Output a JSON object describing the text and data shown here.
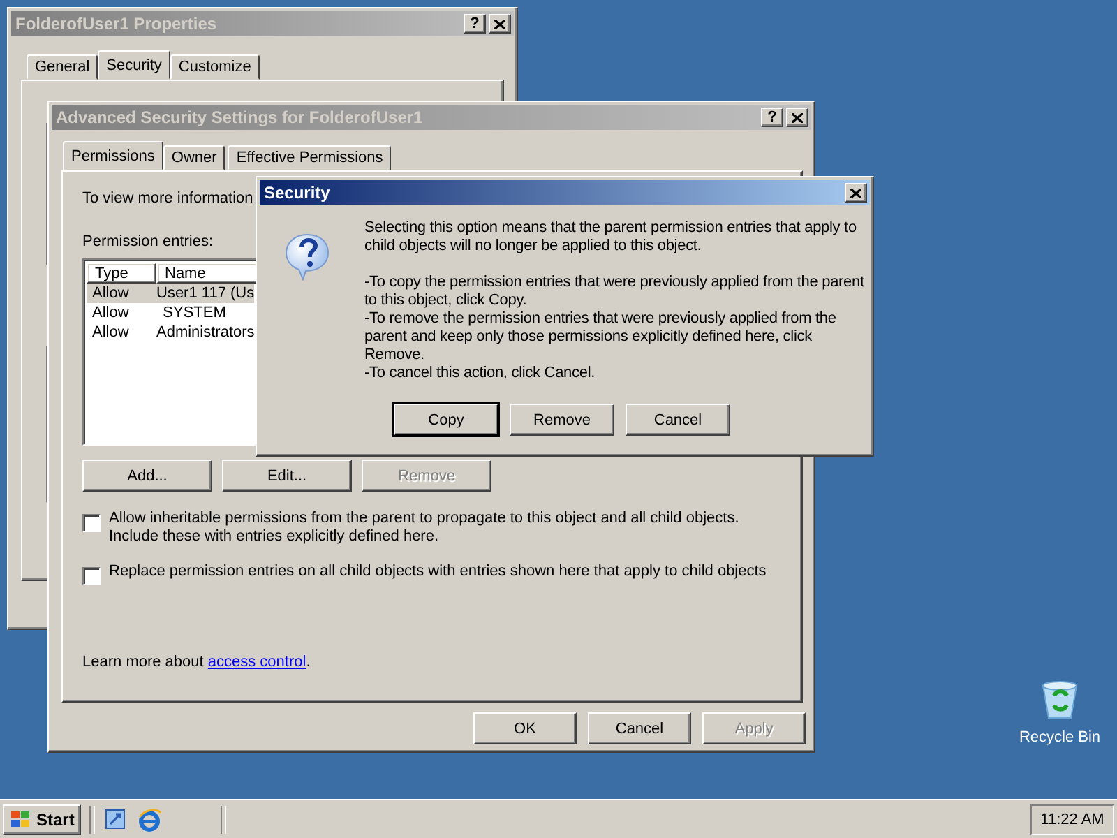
{
  "desktop_icons": [
    {
      "label": "Recycle Bin"
    }
  ],
  "properties_window": {
    "title": "FolderofUser1 Properties",
    "help": "?",
    "active": false,
    "tabs": [
      {
        "label": "General",
        "selected": false
      },
      {
        "label": "Security",
        "selected": true
      },
      {
        "label": "Customize",
        "selected": false
      }
    ]
  },
  "advanced_window": {
    "title": "Advanced Security Settings for FolderofUser1",
    "help": "?",
    "active": false,
    "tabs": [
      {
        "label": "Permissions",
        "selected": true
      },
      {
        "label": "Owner",
        "selected": false
      },
      {
        "label": "Effective Permissions",
        "selected": false
      }
    ],
    "intro": "To view more information",
    "entries_label": "Permission entries:",
    "columns": [
      "Type",
      "Name"
    ],
    "rows": [
      {
        "type": "Allow",
        "name": "User1 117 (Us",
        "selected": true
      },
      {
        "type": "Allow",
        "name": "SYSTEM",
        "selected": false
      },
      {
        "type": "Allow",
        "name": "Administrators",
        "selected": false
      }
    ],
    "entry_buttons": [
      {
        "label": "Add...",
        "disabled": false
      },
      {
        "label": "Edit...",
        "disabled": false
      },
      {
        "label": "Remove",
        "disabled": true
      }
    ],
    "checkboxes": [
      {
        "label": "Allow inheritable permissions from the parent to propagate to this object and all child objects. Include these with entries explicitly defined here.",
        "checked": false
      },
      {
        "label": "Replace permission entries on all child objects with entries shown here that apply to child objects",
        "checked": false
      }
    ],
    "learn_more": {
      "text": "Learn more about ",
      "link": "access control",
      "tail": "."
    },
    "footer_buttons": [
      {
        "label": "OK",
        "disabled": false
      },
      {
        "label": "Cancel",
        "disabled": false
      },
      {
        "label": "Apply",
        "disabled": true
      }
    ]
  },
  "security_dialog": {
    "title": "Security",
    "active": true,
    "paragraphs": [
      "Selecting this option means that the parent permission entries that apply to child objects will no longer be applied to this object.",
      "-To copy  the permission entries that were previously applied from the parent to this object, click Copy.",
      "-To remove the permission entries that were previously applied from the parent and keep only those permissions explicitly defined here, click Remove.",
      "-To cancel this action, click Cancel."
    ],
    "buttons": [
      {
        "label": "Copy",
        "default": true
      },
      {
        "label": "Remove",
        "default": false
      },
      {
        "label": "Cancel",
        "default": false
      }
    ]
  },
  "taskbar": {
    "start": "Start",
    "clock": "11:22 AM"
  }
}
